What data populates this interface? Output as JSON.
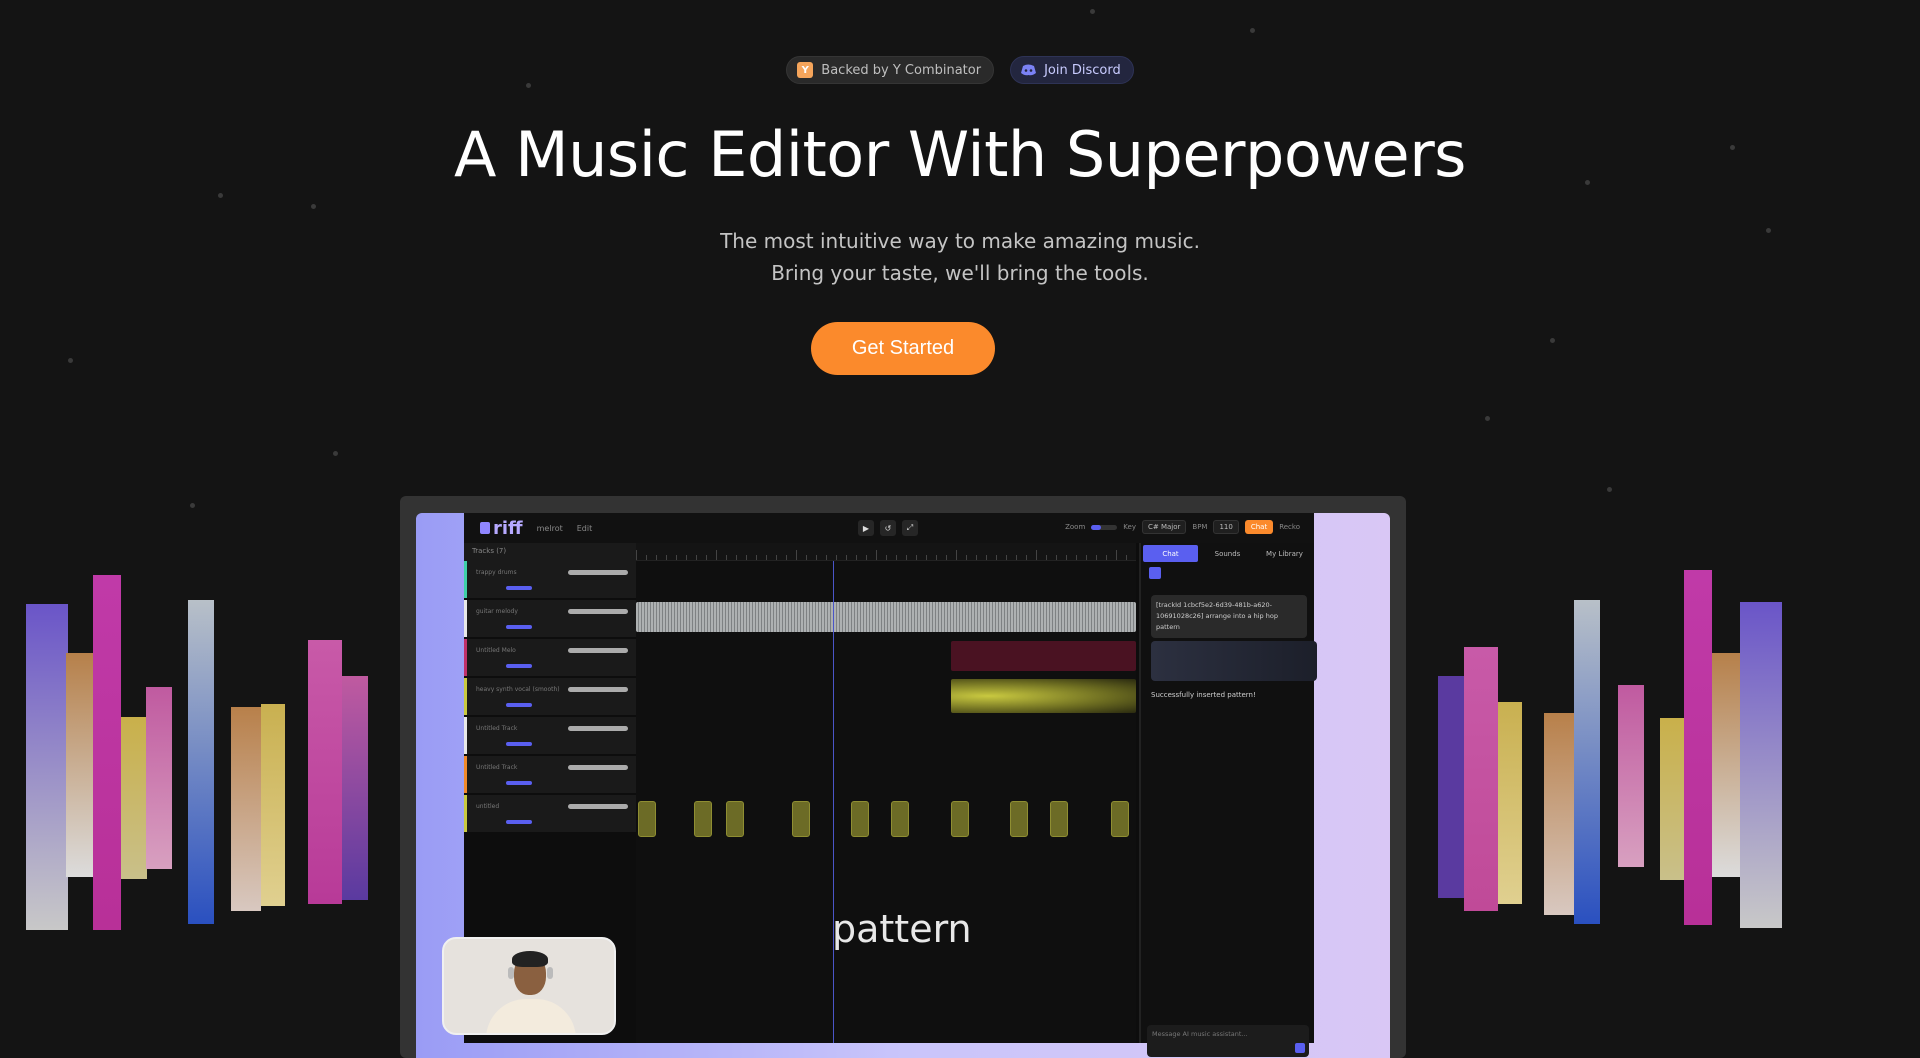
{
  "badges": {
    "yc_logo_letter": "Y",
    "yc_label": "Backed by Y Combinator",
    "discord_label": "Join Discord"
  },
  "hero": {
    "title": "A Music Editor With Superpowers",
    "subtitle_line1": "The most intuitive way to make amazing music.",
    "subtitle_line2": "Bring your taste, we'll bring the tools.",
    "cta_label": "Get Started"
  },
  "app": {
    "logo": "riff",
    "menu": [
      "melrot",
      "Edit"
    ],
    "transport": {
      "play_icon": "play-icon",
      "loop_icon": "loop-icon",
      "expand_icon": "expand-icon"
    },
    "zoom_label": "Zoom",
    "key_label": "Key",
    "key_value": "C# Major",
    "bpm_label": "BPM",
    "bpm_value": "110",
    "chat_button": "Chat",
    "user_name": "Recko",
    "tracks_header": "Tracks (7)",
    "tracks": [
      {
        "name": "trappy drums",
        "color": "#3fd0a8"
      },
      {
        "name": "guitar melody",
        "color": "#e8e8e8"
      },
      {
        "name": "Untitled Melo",
        "color": "#c0306a"
      },
      {
        "name": "heavy synth vocal (smooth)",
        "color": "#c9c940"
      },
      {
        "name": "Untitled Track",
        "color": "#e8e8e8"
      },
      {
        "name": "Untitled Track",
        "color": "#f08a2c"
      },
      {
        "name": "untitled",
        "color": "#c9c940"
      }
    ],
    "overlay_text": "pattern",
    "panel": {
      "tabs": [
        "Chat",
        "Sounds",
        "My Library"
      ],
      "message": "[trackId 1cbcf5e2-6d39-481b-a620-10691028c26] arrange into a hip hop pattern",
      "success": "Successfully inserted pattern!",
      "input_placeholder": "Message AI music assistant..."
    }
  },
  "accent_colors": {
    "cta": "#fb8a2c",
    "brand": "#5a5ff0"
  }
}
